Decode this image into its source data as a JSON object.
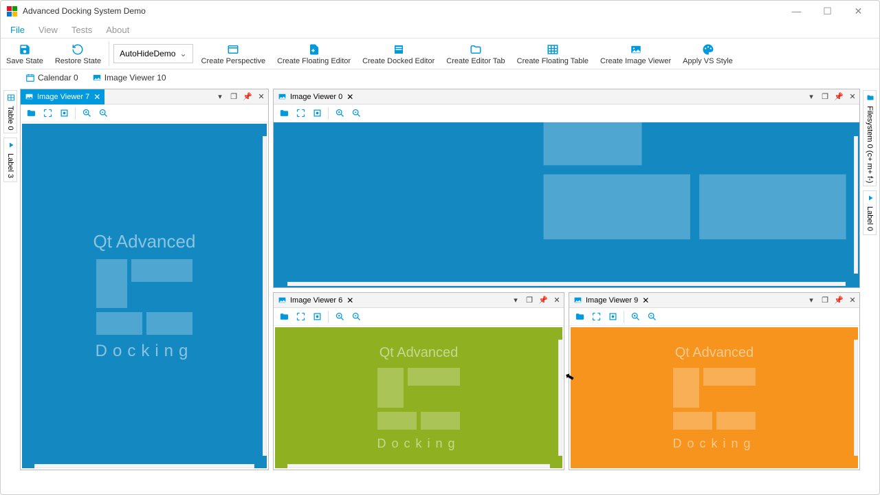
{
  "window": {
    "title": "Advanced Docking System Demo"
  },
  "menu": {
    "file": "File",
    "view": "View",
    "tests": "Tests",
    "about": "About"
  },
  "toolbar": {
    "save": "Save State",
    "restore": "Restore State",
    "perspective_selected": "AutoHideDemo",
    "create_perspective": "Create Perspective",
    "create_floating_editor": "Create Floating Editor",
    "create_docked_editor": "Create Docked Editor",
    "create_editor_tab": "Create Editor Tab",
    "create_floating_table": "Create Floating Table",
    "create_image_viewer": "Create Image Viewer",
    "apply_vs_style": "Apply VS Style"
  },
  "upper_tabs": {
    "calendar": "Calendar 0",
    "image_viewer": "Image Viewer 10"
  },
  "left_side": {
    "table": "Table 0",
    "label": "Label 3"
  },
  "right_side": {
    "filesystem": "Filesystem 0 (c+ m+ f-)",
    "label": "Label 0"
  },
  "panes": {
    "p7": {
      "title": "Image Viewer 7"
    },
    "p0": {
      "title": "Image Viewer 0"
    },
    "p6": {
      "title": "Image Viewer 6"
    },
    "p9": {
      "title": "Image Viewer 9"
    }
  },
  "logo": {
    "line1": "Qt Advanced",
    "line2": "Docking"
  },
  "colors": {
    "accent": "#0099dd",
    "pane_blue": "#1488c0",
    "pane_green": "#8eb021",
    "pane_orange": "#f7941e"
  }
}
